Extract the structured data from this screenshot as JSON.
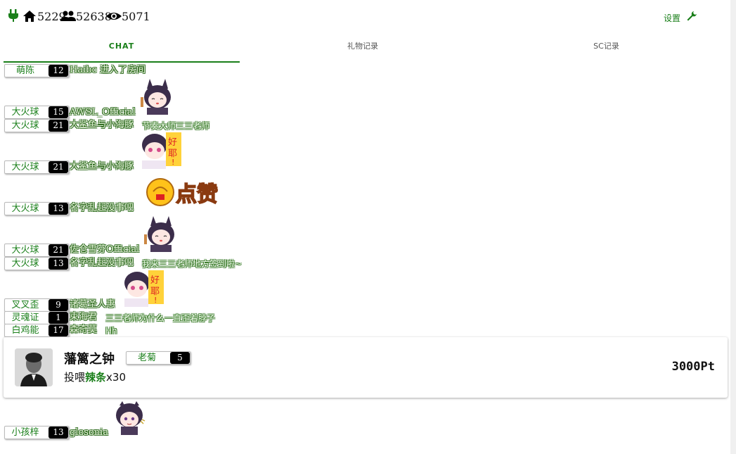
{
  "stats": {
    "popularity": "5229",
    "fans": "52638",
    "viewers": "5071"
  },
  "settings_label": "设置",
  "tabs": [
    {
      "label": "CHAT",
      "active": true
    },
    {
      "label": "礼物记录",
      "active": false
    },
    {
      "label": "SC记录",
      "active": false
    }
  ],
  "chat": [
    {
      "medal": "萌陈",
      "level": "12",
      "user": "Haibc 进入了房间",
      "msg": ""
    },
    {
      "medal": "大火球",
      "level": "15",
      "user": "AWSL_Official",
      "msg": "",
      "emote": "bunny-girl-emote"
    },
    {
      "medal": "大火球",
      "level": "21",
      "user": "大鲨鱼与小海豚",
      "msg": "节奏大师三三老师"
    },
    {
      "medal": "大火球",
      "level": "21",
      "user": "大鲨鱼与小海豚",
      "msg": "",
      "emote": "haoye-emote"
    },
    {
      "medal": "大火球",
      "level": "13",
      "user": "名字乱起没事吧",
      "msg": "",
      "emote": "dianzan-emote"
    },
    {
      "medal": "大火球",
      "level": "21",
      "user": "佐仓雪芬Official",
      "msg": "",
      "emote": "bunny-girl-emote"
    },
    {
      "medal": "大火球",
      "level": "13",
      "user": "名字乱起没事吧",
      "msg": "我来三三老师地方签到啦~"
    },
    {
      "medal": "叉叉歪",
      "level": "9",
      "user": "诸葛圣人惠",
      "msg": "",
      "emote": "haoye-emote"
    },
    {
      "medal": "灵魂证",
      "level": "1",
      "user": "束海君",
      "msg": "三三老师为什么一直歪着脖子"
    },
    {
      "medal": "白鸡能",
      "level": "17",
      "user": "森奇莫",
      "msg": "Hh"
    },
    {
      "medal": "小孩梓",
      "level": "13",
      "user": "glosonia",
      "msg": "",
      "emote": "chibi-girl-emote"
    }
  ],
  "gift": {
    "user": "藩篱之钟",
    "medal": "老菊",
    "level": "5",
    "action": "投喂",
    "item": "辣条",
    "count": "x30",
    "price": "3000Pt"
  },
  "colors": {
    "accent": "#1a7f1a",
    "medal_level_bg": "#000000"
  }
}
